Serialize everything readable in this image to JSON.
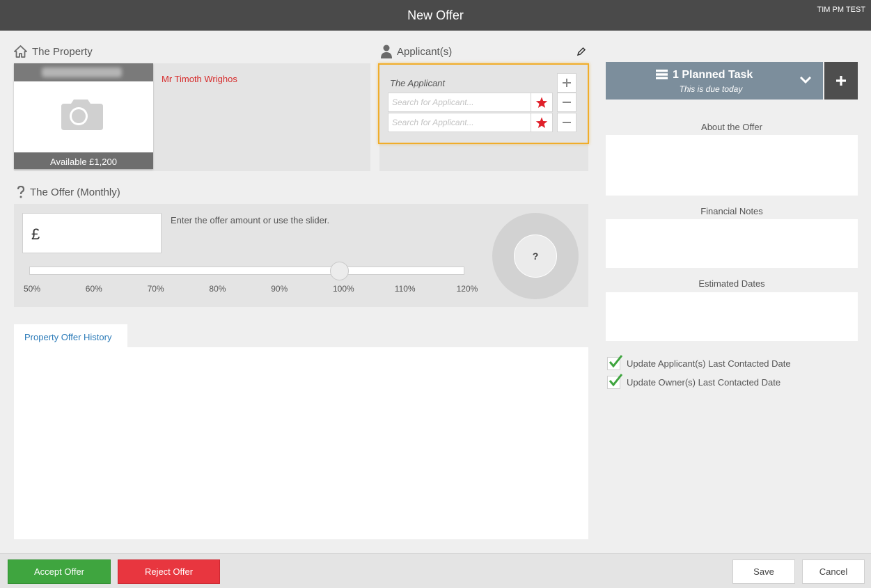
{
  "window": {
    "title": "New Offer",
    "user": "TIM PM TEST"
  },
  "property": {
    "heading": "The Property",
    "availability": "Available £1,200",
    "owner_name": "Mr Timoth Wrighos"
  },
  "applicants": {
    "heading": "Applicant(s)",
    "label": "The Applicant",
    "search_placeholder": "Search for Applicant...",
    "highlight_color": "#f0ad2b"
  },
  "offer": {
    "heading": "The Offer (Monthly)",
    "currency_symbol": "£",
    "hint": "Enter the offer amount or use the slider.",
    "slider_value_percent": 100,
    "ticks": [
      "50%",
      "60%",
      "70%",
      "80%",
      "90%",
      "100%",
      "110%",
      "120%"
    ],
    "gauge_text": "?"
  },
  "history": {
    "tab_label": "Property Offer History"
  },
  "tasks": {
    "title": "1 Planned Task",
    "subtitle": "This is due today"
  },
  "notes": {
    "about_label": "About the Offer",
    "financial_label": "Financial Notes",
    "dates_label": "Estimated Dates"
  },
  "checks": [
    {
      "label": "Update Applicant(s) Last Contacted Date",
      "checked": true
    },
    {
      "label": "Update Owner(s) Last Contacted Date",
      "checked": true
    }
  ],
  "footer": {
    "accept_label": "Accept Offer",
    "reject_label": "Reject Offer",
    "save_label": "Save",
    "cancel_label": "Cancel",
    "accept_color": "#3fa53f",
    "reject_color": "#e8363f"
  }
}
